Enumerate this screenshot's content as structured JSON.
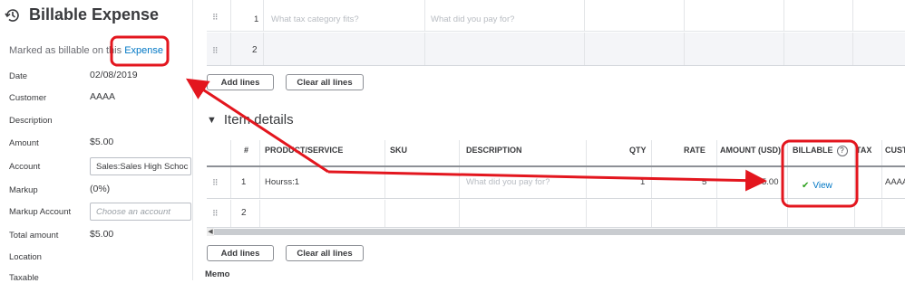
{
  "panel": {
    "title": "Billable Expense",
    "marked_prefix": "Marked as billable on this ",
    "marked_link": "Expense",
    "fields": {
      "date_label": "Date",
      "date_value": "02/08/2019",
      "customer_label": "Customer",
      "customer_value": "AAAA",
      "description_label": "Description",
      "amount_label": "Amount",
      "amount_value": "$5.00",
      "account_label": "Account",
      "account_value": "Sales:Sales High Schoc",
      "markup_label": "Markup",
      "markup_value": "(0%)",
      "markup_account_label": "Markup Account",
      "markup_account_placeholder": "Choose an account",
      "total_label": "Total amount",
      "total_value": "$5.00",
      "location_label": "Location",
      "taxable_label": "Taxable"
    }
  },
  "category_table": {
    "row1_num": "1",
    "row1_category_placeholder": "What tax category fits?",
    "row1_description_placeholder": "What did you pay for?",
    "row2_num": "2"
  },
  "buttons": {
    "add_lines": "Add lines",
    "clear_all_lines": "Clear all lines"
  },
  "item_details": {
    "title": "Item details",
    "headers": {
      "num": "#",
      "product": "PRODUCT/SERVICE",
      "sku": "SKU",
      "description": "DESCRIPTION",
      "qty": "QTY",
      "rate": "RATE",
      "amount": "AMOUNT (USD)",
      "billable": "BILLABLE",
      "tax": "TAX",
      "customer": "CUST"
    },
    "row1": {
      "num": "1",
      "product": "Hourss:1",
      "description_placeholder": "What did you pay for?",
      "qty": "1",
      "rate": "5",
      "amount": "5.00",
      "billable_link": "View",
      "customer": "AAAA"
    },
    "row2_num": "2"
  },
  "memo_label": "Memo",
  "icons": {
    "history": "history-icon",
    "caret": "caret-down-icon",
    "check": "check-icon",
    "help": "question-circle-icon",
    "drag": "drag-handle-icon"
  },
  "colors": {
    "link": "#0077c5",
    "annotation": "#e3161e",
    "check": "#2ca01c"
  }
}
